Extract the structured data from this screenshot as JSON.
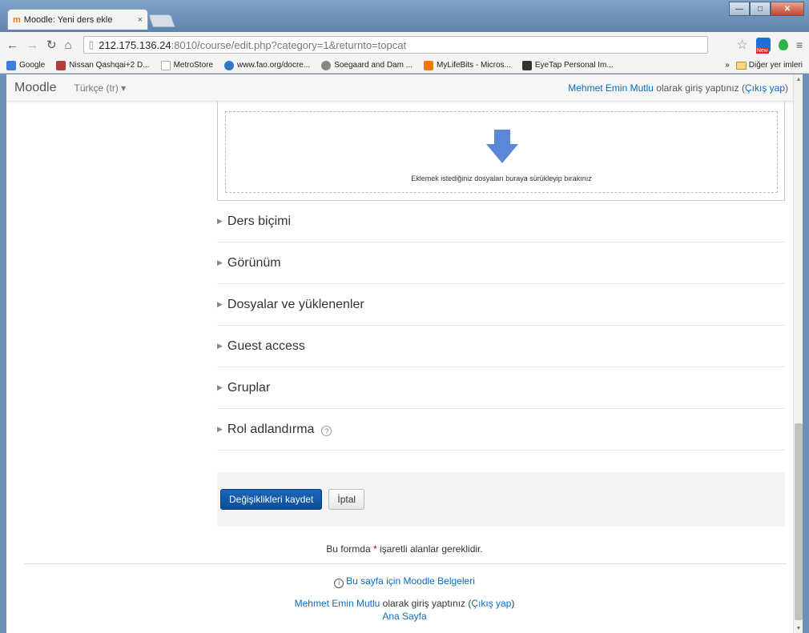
{
  "browser": {
    "tab_title": "Moodle: Yeni ders ekle",
    "tab_close": "×",
    "tab_favicon": "moodle-m",
    "url_host": "212.175.136.24",
    "url_rest": ":8010/course/edit.php?category=1&returnto=topcat",
    "bookmarks": [
      {
        "label": "Google",
        "color": "#3b7ddd"
      },
      {
        "label": "Nissan Qashqai+2 D...",
        "color": "#b53a3a"
      },
      {
        "label": "MetroStore",
        "color": "#cccccc"
      },
      {
        "label": "www.fao.org/docre...",
        "color": "#2d79c7"
      },
      {
        "label": "Soegaard and Dam ...",
        "color": "#888888"
      },
      {
        "label": "MyLifeBits - Micros...",
        "color": "#f07a00"
      },
      {
        "label": "EyeTap Personal Im...",
        "color": "#333333"
      }
    ],
    "bookmarks_more": "»",
    "other_bookmarks": "Diğer yer imleri"
  },
  "navbar": {
    "brand": "Moodle",
    "language": "Türkçe (tr)",
    "user_name": "Mehmet Emin Mutlu",
    "logged_in_text": " olarak giriş yaptınız (",
    "logout": "Çıkış yap",
    "close_paren": ")"
  },
  "dropzone": {
    "text": "Eklemek istediğiniz dosyaları buraya sürükleyip bırakınız",
    "arrow_color": "#5b87d9"
  },
  "sections": [
    {
      "label": "Ders biçimi"
    },
    {
      "label": "Görünüm"
    },
    {
      "label": "Dosyalar ve yüklenenler"
    },
    {
      "label": "Guest access"
    },
    {
      "label": "Gruplar"
    },
    {
      "label": "Rol adlandırma"
    }
  ],
  "actions": {
    "save": "Değişiklikleri kaydet",
    "cancel": "İptal"
  },
  "required_note": {
    "before": "Bu formda ",
    "asterisk": "*",
    "after": " işaretli alanlar gereklidir."
  },
  "footer": {
    "docs_link": "Bu sayfa için Moodle Belgeleri",
    "user_name": "Mehmet Emin Mutlu",
    "logged_in_text": " olarak giriş yaptınız (",
    "logout": "Çıkış yap",
    "close_paren": ")",
    "home": "Ana Sayfa"
  },
  "colors": {
    "link": "#0a6cc2",
    "primary_button": "#0a4d9a"
  }
}
